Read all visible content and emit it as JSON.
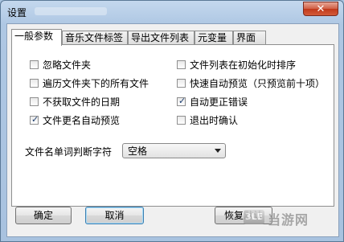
{
  "window": {
    "title": "设置",
    "close_glyph": "✕"
  },
  "tabs": [
    {
      "label": "一般参数",
      "active": true
    },
    {
      "label": "音乐文件标签",
      "active": false
    },
    {
      "label": "导出文件列表",
      "active": false
    },
    {
      "label": "元变量",
      "active": false
    },
    {
      "label": "界面",
      "active": false
    }
  ],
  "options": {
    "ignore_folder": {
      "label": "忽略文件夹",
      "checked": false
    },
    "traverse_subfolders": {
      "label": "遍历文件夹下的所有文件",
      "checked": false
    },
    "no_file_date": {
      "label": "不获取文件的日期",
      "checked": false
    },
    "auto_preview_rename": {
      "label": "文件更名自动预览",
      "checked": true
    },
    "sort_on_init": {
      "label": "文件列表在初始化时排序",
      "checked": false
    },
    "quick_preview": {
      "label": "快速自动预览（只预览前十项）",
      "checked": false
    },
    "auto_correct": {
      "label": "自动更正错误",
      "checked": true
    },
    "confirm_exit": {
      "label": "退出时确认",
      "checked": false
    }
  },
  "word_separator": {
    "label": "文件名单词判断字符",
    "value": "空格"
  },
  "buttons": {
    "ok": "确定",
    "cancel": "取消",
    "restore_defaults": "恢复默认"
  },
  "watermark": {
    "logo_text": "3LE",
    "text": "当游网"
  },
  "colors": {
    "check_mark": "#1c3d6e",
    "close_button": "#c1391a"
  }
}
